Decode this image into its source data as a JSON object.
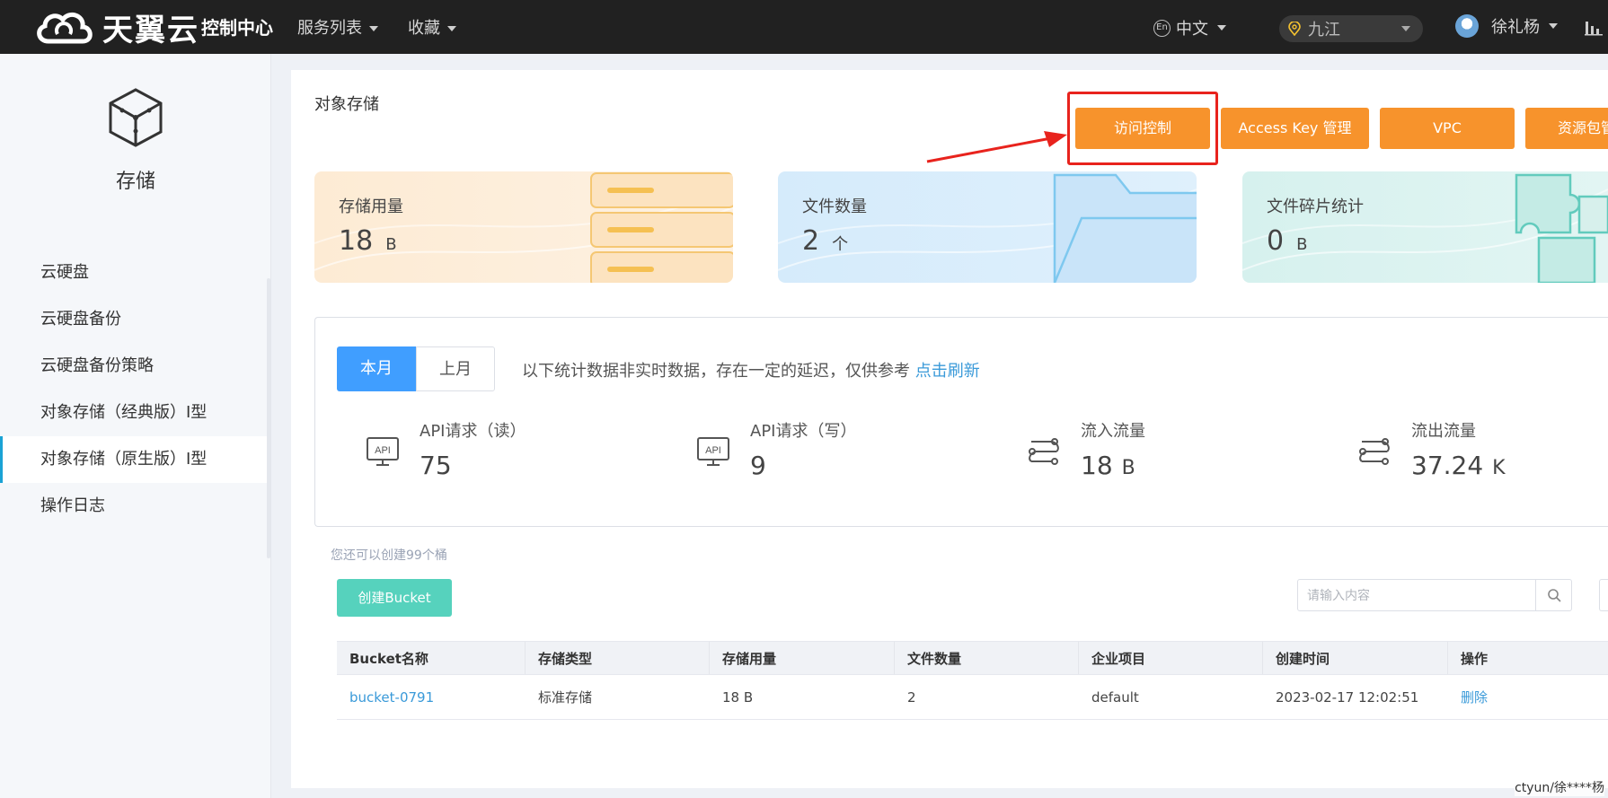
{
  "brand": {
    "name": "天翼云",
    "console": "控制中心"
  },
  "topnav": {
    "services": "服务列表",
    "favorites": "收藏",
    "language": "中文",
    "lang_icon": "En",
    "region": "九江",
    "user": "徐礼杨"
  },
  "sidebar": {
    "title": "存储",
    "items": [
      {
        "label": "云硬盘"
      },
      {
        "label": "云硬盘备份"
      },
      {
        "label": "云硬盘备份策略"
      },
      {
        "label": "对象存储（经典版）Ⅰ型"
      },
      {
        "label": "对象存储（原生版）Ⅰ型"
      },
      {
        "label": "操作日志"
      }
    ]
  },
  "page": {
    "title": "对象存储",
    "actions": [
      "访问控制",
      "Access Key 管理",
      "VPC",
      "资源包管"
    ]
  },
  "stats": [
    {
      "label": "存储用量",
      "value": "18",
      "unit": "B"
    },
    {
      "label": "文件数量",
      "value": "2",
      "unit": "个"
    },
    {
      "label": "文件碎片统计",
      "value": "0",
      "unit": "B"
    }
  ],
  "traffic": {
    "tabs": [
      "本月",
      "上月"
    ],
    "note": "以下统计数据非实时数据，存在一定的延迟，仅供参考",
    "refresh": "点击刷新",
    "metrics": [
      {
        "label": "API请求（读）",
        "value": "75",
        "unit": "",
        "icon": "api-monitor-icon",
        "icon_text": "API"
      },
      {
        "label": "API请求（写）",
        "value": "9",
        "unit": "",
        "icon": "api-monitor-icon",
        "icon_text": "API"
      },
      {
        "label": "流入流量",
        "value": "18",
        "unit": "B",
        "icon": "flow-icon"
      },
      {
        "label": "流出流量",
        "value": "37.24",
        "unit": "K",
        "icon": "flow-icon"
      }
    ]
  },
  "buckets": {
    "quota_text": "您还可以创建99个桶",
    "create_label": "创建Bucket",
    "search_placeholder": "请输入内容",
    "columns": [
      "Bucket名称",
      "存储类型",
      "存储用量",
      "文件数量",
      "企业项目",
      "创建时间",
      "操作"
    ],
    "rows": [
      {
        "name": "bucket-0791",
        "type": "标准存储",
        "usage": "18 B",
        "files": "2",
        "project": "default",
        "created": "2023-02-17 12:02:51",
        "action": "删除"
      }
    ]
  },
  "watermark": "ctyun/徐****杨",
  "colors": {
    "topbar": "#212121",
    "accent_orange": "#f7932c",
    "tab_blue": "#409eff",
    "create_green": "#56d2bd",
    "link_blue": "#3a9ad9",
    "highlight_red": "#e8231d"
  }
}
